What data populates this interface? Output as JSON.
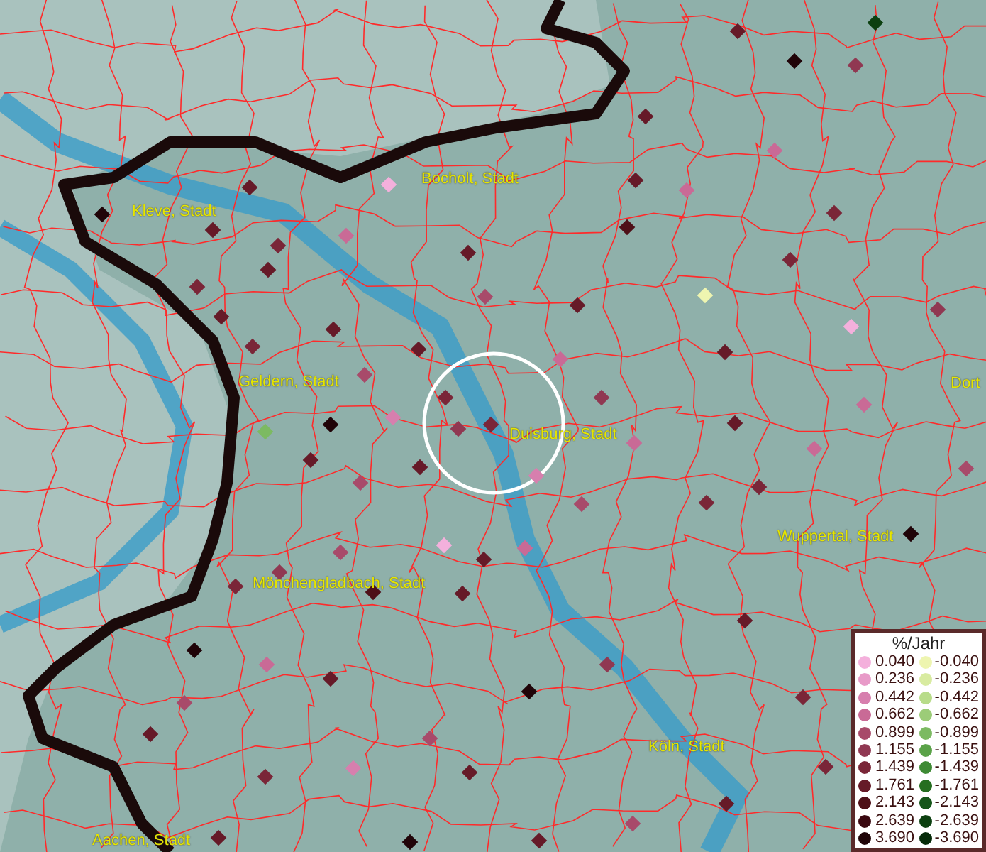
{
  "map": {
    "places": [
      {
        "name": "Bocholt, Stadt"
      },
      {
        "name": "Kleve, Stadt"
      },
      {
        "name": "Geldern, Stadt"
      },
      {
        "name": "Duisburg, Stadt"
      },
      {
        "name": "Dort"
      },
      {
        "name": "Wuppertal, Stadt"
      },
      {
        "name": "Mönchengladbach, Stadt"
      },
      {
        "name": "Köln, Stadt"
      },
      {
        "name": "Aachen, Stadt"
      }
    ]
  },
  "legend": {
    "title": "%/Jahr",
    "rows": [
      {
        "positive": {
          "label": "0.040",
          "color": "#f4b0dc"
        },
        "negative": {
          "label": "-0.040",
          "color": "#eef5b0"
        }
      },
      {
        "positive": {
          "label": "0.236",
          "color": "#e89ac8"
        },
        "negative": {
          "label": "-0.236",
          "color": "#d8eba0"
        }
      },
      {
        "positive": {
          "label": "0.442",
          "color": "#d77fae"
        },
        "negative": {
          "label": "-0.442",
          "color": "#b8dc8a"
        }
      },
      {
        "positive": {
          "label": "0.662",
          "color": "#c96a96"
        },
        "negative": {
          "label": "-0.662",
          "color": "#9ccc78"
        }
      },
      {
        "positive": {
          "label": "0.899",
          "color": "#a84a6a"
        },
        "negative": {
          "label": "-0.899",
          "color": "#7cba62"
        }
      },
      {
        "positive": {
          "label": "1.155",
          "color": "#903852"
        },
        "negative": {
          "label": "-1.155",
          "color": "#5aa248"
        }
      },
      {
        "positive": {
          "label": "1.439",
          "color": "#7a2638"
        },
        "negative": {
          "label": "-1.439",
          "color": "#3e8a34"
        }
      },
      {
        "positive": {
          "label": "1.761",
          "color": "#661a28"
        },
        "negative": {
          "label": "-1.761",
          "color": "#266e20"
        }
      },
      {
        "positive": {
          "label": "2.143",
          "color": "#4e1018"
        },
        "negative": {
          "label": "-2.143",
          "color": "#16561a"
        }
      },
      {
        "positive": {
          "label": "2.639",
          "color": "#3a0810"
        },
        "negative": {
          "label": "-2.639",
          "color": "#0c4010"
        }
      },
      {
        "positive": {
          "label": "3.690",
          "color": "#200408"
        },
        "negative": {
          "label": "-3.690",
          "color": "#062a08"
        }
      }
    ]
  }
}
